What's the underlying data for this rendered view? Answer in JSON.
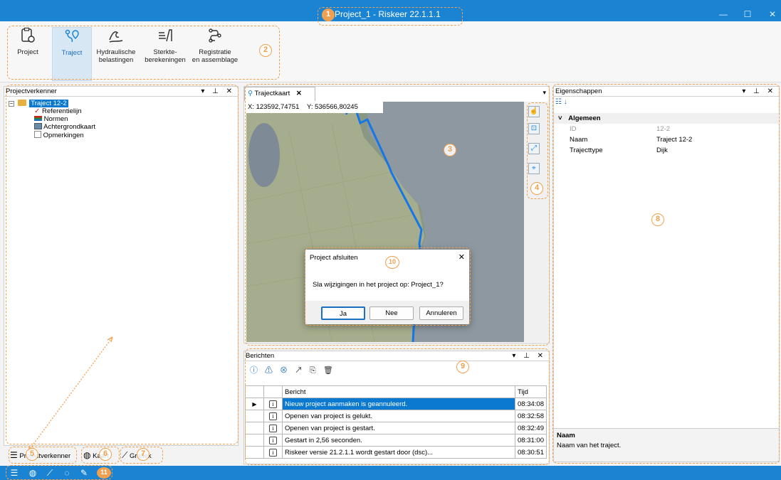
{
  "app": {
    "title": "Project_1 - Riskeer 22.1.1.1"
  },
  "window_controls": {
    "minimize": "—",
    "maximize": "☐",
    "close": "✕"
  },
  "ribbon": {
    "buttons": [
      {
        "line1": "Project",
        "line2": "",
        "icon": "clipboard-gear-icon"
      },
      {
        "line1": "Traject",
        "line2": "",
        "icon": "route-pin-icon",
        "selected": true
      },
      {
        "line1": "Hydraulische",
        "line2": "belastingen",
        "icon": "wave-icon"
      },
      {
        "line1": "Sterkte-",
        "line2": "berekeningen",
        "icon": "dike-icon"
      },
      {
        "line1": "Registratie",
        "line2": "en assemblage",
        "icon": "flow-icon"
      }
    ]
  },
  "project_explorer": {
    "title": "Projectverkenner",
    "controls": "▾ ⊥ ✕",
    "tree": {
      "root": "Traject 12-2",
      "children": [
        "Referentielijn",
        "Normen",
        "Achtergrondkaart",
        "Opmerkingen"
      ]
    }
  },
  "map": {
    "tab_title": "Trajectkaart",
    "tab_close": "✕",
    "coord_x": "X: 123592,74751",
    "coord_y": "Y: 536566,80245",
    "tools": [
      "pan-icon",
      "zoom-box-icon",
      "zoom-extents-icon",
      "select-feature-icon"
    ]
  },
  "dialog": {
    "title": "Project afsluiten",
    "close": "✕",
    "message": "Sla wijzigingen in het project op: Project_1?",
    "buttons": {
      "yes": "Ja",
      "no": "Nee",
      "cancel": "Annuleren"
    }
  },
  "messages": {
    "title": "Berichten",
    "controls": "▾ ⊥ ✕",
    "columns": {
      "message": "Bericht",
      "time": "Tijd"
    },
    "rows": [
      {
        "message": "Nieuw project aanmaken is geannuleerd.",
        "time": "08:34:08",
        "selected": true
      },
      {
        "message": "Openen van project is gelukt.",
        "time": "08:32:58"
      },
      {
        "message": "Openen van project is gestart.",
        "time": "08:32:49"
      },
      {
        "message": "Gestart in 2,56 seconden.",
        "time": "08:31:00"
      },
      {
        "message": "Riskeer versie 21.2.1.1 wordt gestart door  (dsc)...",
        "time": "08:30:51"
      }
    ]
  },
  "properties": {
    "title": "Eigenschappen",
    "controls": "▾ ⊥ ✕",
    "category": "Algemeen",
    "rows": [
      {
        "label": "ID",
        "value": "12-2",
        "readonly": true
      },
      {
        "label": "Naam",
        "value": "Traject 12-2"
      },
      {
        "label": "Trajecttype",
        "value": "Dijk"
      }
    ],
    "help_title": "Naam",
    "help_text": "Naam van het traject."
  },
  "bottom_tabs": {
    "explorer": "Projectverkenner",
    "map": "Kaart",
    "chart": "Grafiek"
  },
  "callouts": [
    "1",
    "2",
    "3",
    "4",
    "5",
    "6",
    "7",
    "8",
    "9",
    "10",
    "11"
  ],
  "colors": {
    "accent": "#1a84d2",
    "callout": "#f0a050",
    "selected_row": "#0b79d0"
  }
}
